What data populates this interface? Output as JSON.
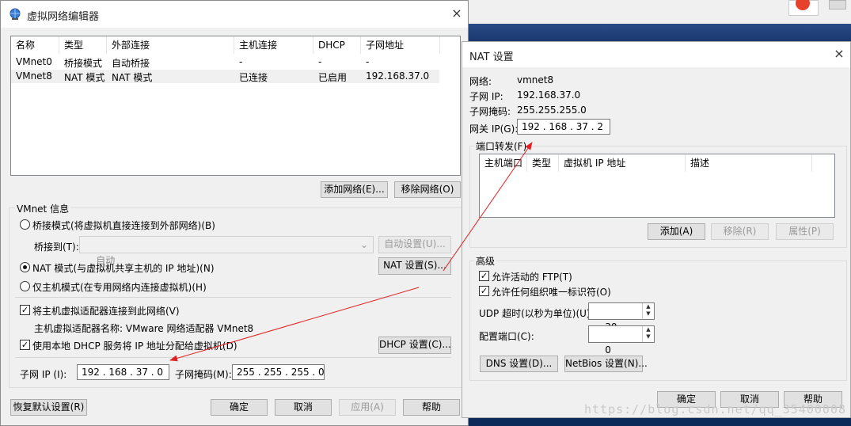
{
  "vne": {
    "title": "虚拟网络编辑器",
    "list_headers": [
      "名称",
      "类型",
      "外部连接",
      "主机连接",
      "DHCP",
      "子网地址"
    ],
    "rows": [
      [
        "VMnet0",
        "桥接模式",
        "自动桥接",
        "-",
        "-",
        "-"
      ],
      [
        "VMnet8",
        "NAT 模式",
        "NAT 模式",
        "已连接",
        "已启用",
        "192.168.37.0"
      ]
    ],
    "add_network": "添加网络(E)...",
    "remove_network": "移除网络(O)",
    "group_label": "VMnet 信息",
    "bridge_mode": "桥接模式(将虚拟机直接连接到外部网络)(B)",
    "bridge_to_label": "桥接到(T):",
    "bridge_to_value": "自动",
    "auto_settings": "自动设置(U)...",
    "nat_mode": "NAT 模式(与虚拟机共享主机的 IP 地址)(N)",
    "nat_settings": "NAT 设置(S)...",
    "host_only": "仅主机模式(在专用网络内连接虚拟机)(H)",
    "connect_adapter": "将主机虚拟适配器连接到此网络(V)",
    "adapter_name": "主机虚拟适配器名称: VMware 网络适配器 VMnet8",
    "use_dhcp": "使用本地 DHCP 服务将 IP 地址分配给虚拟机(D)",
    "dhcp_settings": "DHCP 设置(C)...",
    "subnet_ip_label": "子网 IP (I):",
    "subnet_ip_value": "192 . 168 . 37 . 0",
    "subnet_mask_label": "子网掩码(M):",
    "subnet_mask_value": "255 . 255 . 255 . 0",
    "restore_defaults": "恢复默认设置(R)",
    "ok": "确定",
    "cancel": "取消",
    "apply": "应用(A)",
    "help": "帮助",
    "close": "×"
  },
  "nat": {
    "title": "NAT 设置",
    "network_label": "网络:",
    "network_value": "vmnet8",
    "subnet_ip_label": "子网 IP:",
    "subnet_ip_value": "192.168.37.0",
    "subnet_mask_label": "子网掩码:",
    "subnet_mask_value": "255.255.255.0",
    "gateway_label": "网关 IP(G):",
    "gateway_value": "192 . 168 . 37 . 2",
    "port_forwarding": "端口转发(F)",
    "pf_headers": [
      "主机端口",
      "类型",
      "虚拟机 IP 地址",
      "描述"
    ],
    "add": "添加(A)",
    "remove": "移除(R)",
    "properties": "属性(P)",
    "advanced": "高级",
    "allow_ftp": "允许活动的 FTP(T)",
    "allow_oui": "允许任何组织唯一标识符(O)",
    "udp_timeout_label": "UDP 超时(以秒为单位)(U):",
    "udp_timeout_value": "30",
    "config_port_label": "配置端口(C):",
    "config_port_value": "0",
    "dns_settings": "DNS 设置(D)...",
    "netbios_settings": "NetBios 设置(N)...",
    "ok": "确定",
    "cancel": "取消",
    "help": "帮助",
    "close": "×"
  },
  "watermark": "https://blog.csdn.net/qq_35400008",
  "colors": {
    "arrow": "#e02020",
    "desktop": "#0b2a5a"
  }
}
